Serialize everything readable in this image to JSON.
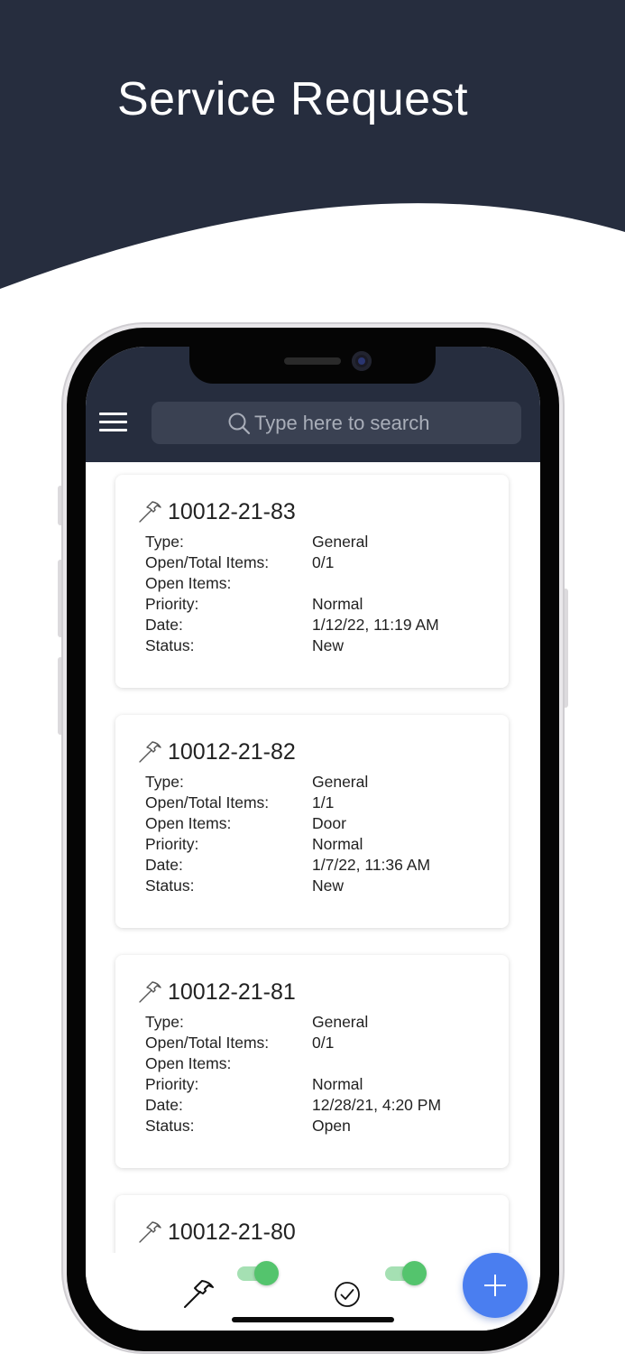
{
  "banner": {
    "title": "Service Request",
    "colors": {
      "background": "#262d3e",
      "title": "#ffffff"
    }
  },
  "app_header": {
    "menu_icon": "hamburger-menu-icon",
    "search": {
      "icon": "search-icon",
      "placeholder": "Type here to search",
      "value": ""
    },
    "colors": {
      "header": "#262d3e",
      "search_field": "#3a4152"
    }
  },
  "requests": [
    {
      "id": "10012-21-83",
      "icon": "hammer-icon",
      "fields": [
        {
          "label": "Type:",
          "value": "General"
        },
        {
          "label": "Open/Total Items:",
          "value": "0/1"
        },
        {
          "label": "Open Items:",
          "value": ""
        },
        {
          "label": "Priority:",
          "value": "Normal"
        },
        {
          "label": "Date:",
          "value": "1/12/22, 11:19 AM"
        },
        {
          "label": "Status:",
          "value": "New"
        }
      ]
    },
    {
      "id": "10012-21-82",
      "icon": "hammer-icon",
      "fields": [
        {
          "label": "Type:",
          "value": "General"
        },
        {
          "label": "Open/Total Items:",
          "value": "1/1"
        },
        {
          "label": "Open Items:",
          "value": "Door"
        },
        {
          "label": "Priority:",
          "value": "Normal"
        },
        {
          "label": "Date:",
          "value": "1/7/22, 11:36 AM"
        },
        {
          "label": "Status:",
          "value": "New"
        }
      ]
    },
    {
      "id": "10012-21-81",
      "icon": "hammer-icon",
      "fields": [
        {
          "label": "Type:",
          "value": "General"
        },
        {
          "label": "Open/Total Items:",
          "value": "0/1"
        },
        {
          "label": "Open Items:",
          "value": ""
        },
        {
          "label": "Priority:",
          "value": "Normal"
        },
        {
          "label": "Date:",
          "value": "12/28/21, 4:20 PM"
        },
        {
          "label": "Status:",
          "value": "Open"
        }
      ]
    },
    {
      "id": "10012-21-80",
      "icon": "hammer-icon",
      "fields": []
    }
  ],
  "bottom_bar": {
    "hammer_icon": "hammer-icon",
    "hammer_toggle_on": true,
    "check_icon": "check-circle-icon",
    "check_toggle_on": true,
    "add_icon": "plus-icon",
    "colors": {
      "toggle_knob": "#54c46d",
      "toggle_track": "#a5e0b3",
      "fab": "#4a7ef0"
    }
  }
}
